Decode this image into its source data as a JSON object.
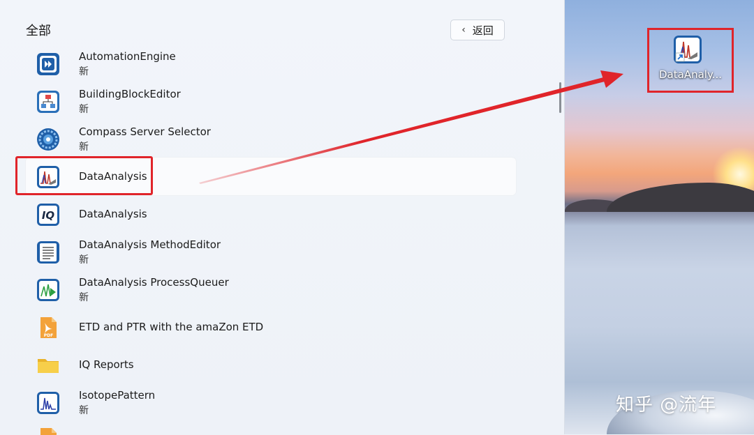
{
  "start_menu": {
    "section_title": "全部",
    "back_button": {
      "chevron": "‹",
      "label": "返回"
    },
    "apps": [
      {
        "name": "AutomationEngine",
        "sub": "新",
        "icon": "automation-engine-icon"
      },
      {
        "name": "BuildingBlockEditor",
        "sub": "新",
        "icon": "building-block-editor-icon"
      },
      {
        "name": "Compass Server Selector",
        "sub": "新",
        "icon": "compass-server-icon"
      },
      {
        "name": "DataAnalysis",
        "sub": "",
        "icon": "data-analysis-icon",
        "selected": true
      },
      {
        "name": "DataAnalysis",
        "sub": "",
        "icon": "iq-icon"
      },
      {
        "name": "DataAnalysis MethodEditor",
        "sub": "新",
        "icon": "method-editor-icon"
      },
      {
        "name": "DataAnalysis ProcessQueuer",
        "sub": "新",
        "icon": "process-queuer-icon"
      },
      {
        "name": "ETD and PTR with the amaZon ETD",
        "sub": "",
        "icon": "pdf-icon"
      },
      {
        "name": "IQ Reports",
        "sub": "",
        "icon": "folder-icon"
      },
      {
        "name": "IsotopePattern",
        "sub": "新",
        "icon": "isotope-pattern-icon"
      }
    ]
  },
  "desktop": {
    "shortcut_label": "DataAnaly...",
    "shortcut_icon": "data-analysis-shortcut-icon",
    "watermark": "知乎 @流年"
  },
  "colors": {
    "annotation_red": "#e0242a",
    "panel_bg": "#f2f5fa"
  }
}
